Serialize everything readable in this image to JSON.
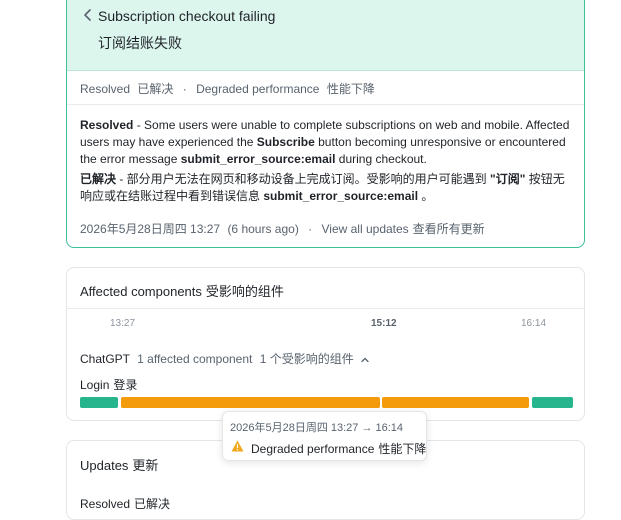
{
  "incident": {
    "title_en": "Subscription checkout failing",
    "title_zh": "订阅结账失败",
    "status_en": "Resolved",
    "status_zh": "已解决",
    "separator": "·",
    "impact_en": "Degraded performance",
    "impact_zh": "性能下降",
    "body_en": {
      "label": "Resolved",
      "text1": " - Some users were unable to complete subscriptions on web and mobile. Affected users may have experienced the ",
      "bold1": "Subscribe",
      "text2": " button becoming unresponsive or encountered the error message ",
      "bold2": "submit_error_source:email",
      "text3": " during checkout."
    },
    "body_zh": {
      "label": "已解决",
      "text1": " - 部分用户无法在网页和移动设备上完成订阅。受影响的用户可能遇到 ",
      "bold1": "\"订阅\"",
      "text2": " 按钮无响应或在结账过程中看到错误信息 ",
      "bold2": "submit_error_source:email",
      "text3": " 。"
    },
    "timestamp": "2026年5月28日周四 13:27",
    "relative_time": "(6 hours ago)",
    "view_updates_en": "View all updates",
    "view_updates_zh": "查看所有更新"
  },
  "components": {
    "title_en": "Affected components",
    "title_zh": "受影响的组件",
    "ticks": [
      "13:27",
      "15:12",
      "16:14"
    ],
    "group_name": "ChatGPT",
    "group_count_en": "1 affected component",
    "group_count_zh": "1 个受影响的组件",
    "component_en": "Login",
    "component_zh": "登录",
    "segments": [
      "operational",
      "degraded",
      "degraded",
      "operational"
    ],
    "colors": {
      "operational": "#26b58d",
      "degraded": "#f49b0b"
    }
  },
  "tooltip": {
    "time_range": "2026年5月28日周四 13:27 → 16:14",
    "status_en": "Degraded performance",
    "status_zh": "性能下降",
    "icon": "warning-icon"
  },
  "updates": {
    "title_en": "Updates",
    "title_zh": "更新",
    "first_en": "Resolved",
    "first_zh": "已解决"
  },
  "icons": {
    "back": "chevron-left-icon",
    "collapse": "chevron-up-icon"
  }
}
